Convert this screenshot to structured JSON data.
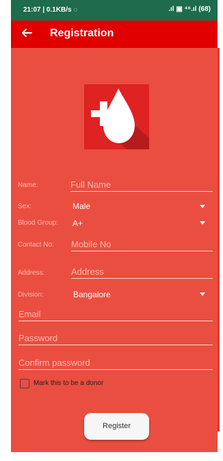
{
  "status_bar": {
    "time_speed": "21:07 | 0.1KB/s ◌",
    "signal_icons": ".ıl ▣ ⁴⁶.ıl (68)"
  },
  "app_bar": {
    "title": "Registration"
  },
  "form": {
    "name": {
      "label": "Name:",
      "placeholder": "Full Name"
    },
    "sex": {
      "label": "Sex:",
      "value": "Male"
    },
    "blood": {
      "label": "Blood Group:",
      "value": "A+"
    },
    "contact": {
      "label": "Contact No:",
      "placeholder": "Mobile No"
    },
    "address": {
      "label": "Address:",
      "placeholder": "Address"
    },
    "division": {
      "label": "Division:",
      "value": "Bangalore"
    },
    "email": {
      "placeholder": "Email"
    },
    "password": {
      "placeholder": "Password"
    },
    "confirm": {
      "placeholder": "Confirm password"
    },
    "donor_checkbox": {
      "label": "Mark this to be a donor",
      "checked": false
    },
    "register_button": "Register"
  },
  "colors": {
    "primary": "#e00000",
    "background": "#ea4e40",
    "status_bar": "#1e6b4d"
  }
}
